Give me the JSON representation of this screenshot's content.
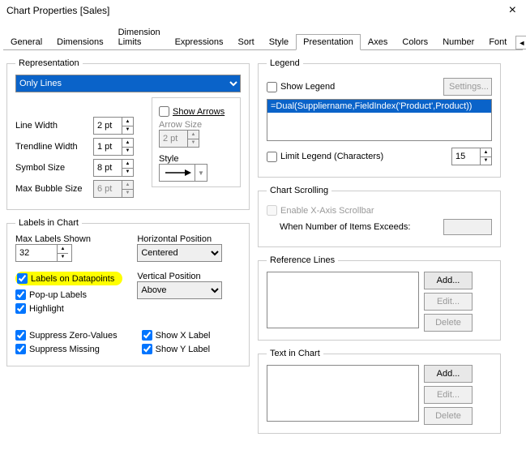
{
  "title": "Chart Properties [Sales]",
  "tabs": [
    "General",
    "Dimensions",
    "Dimension Limits",
    "Expressions",
    "Sort",
    "Style",
    "Presentation",
    "Axes",
    "Colors",
    "Number",
    "Font"
  ],
  "active_tab": "Presentation",
  "rep": {
    "legend": "Representation",
    "mode": "Only Lines",
    "show_arrows": "Show Arrows",
    "arrow_size_lbl": "Arrow Size",
    "arrow_size_val": "2 pt",
    "style_lbl": "Style",
    "line_width_lbl": "Line Width",
    "line_width_val": "2 pt",
    "trend_lbl": "Trendline Width",
    "trend_val": "1 pt",
    "symbol_lbl": "Symbol Size",
    "symbol_val": "8 pt",
    "bubble_lbl": "Max Bubble Size",
    "bubble_val": "6 pt"
  },
  "labels": {
    "legend": "Labels in Chart",
    "max_lbl": "Max Labels Shown",
    "max_val": "32",
    "on_dp": "Labels on Datapoints",
    "popup": "Pop-up Labels",
    "highlight": "Highlight",
    "hpos_lbl": "Horizontal Position",
    "hpos_val": "Centered",
    "vpos_lbl": "Vertical Position",
    "vpos_val": "Above",
    "supp_zero": "Suppress Zero-Values",
    "supp_miss": "Suppress Missing",
    "show_x": "Show X Label",
    "show_y": "Show Y Label"
  },
  "legend_sec": {
    "legend": "Legend",
    "show": "Show Legend",
    "settings": "Settings...",
    "item": "=Dual(Suppliername,FieldIndex('Product',Product))",
    "limit": "Limit Legend (Characters)",
    "limit_val": "15"
  },
  "scroll": {
    "legend": "Chart Scrolling",
    "enable": "Enable X-Axis Scrollbar",
    "exceed": "When Number of Items Exceeds:"
  },
  "ref": {
    "legend": "Reference Lines",
    "add": "Add...",
    "edit": "Edit...",
    "del": "Delete"
  },
  "txt": {
    "legend": "Text in Chart",
    "add": "Add...",
    "edit": "Edit...",
    "del": "Delete"
  }
}
